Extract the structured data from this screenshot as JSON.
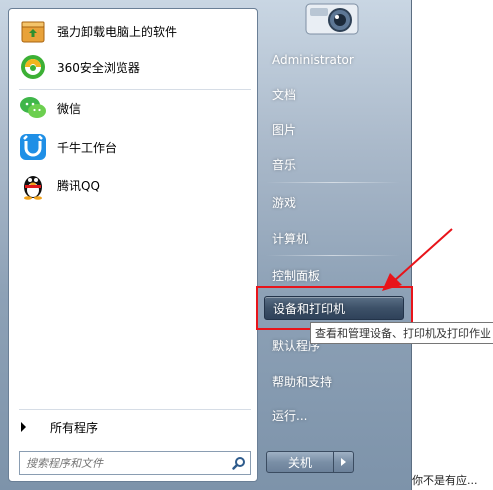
{
  "programs": [
    {
      "label": "强力卸载电脑上的软件",
      "icon": "uninstaller-box-icon"
    },
    {
      "label": "360安全浏览器",
      "icon": "360-browser-icon"
    },
    {
      "label": "微信",
      "icon": "wechat-icon"
    },
    {
      "label": "千牛工作台",
      "icon": "qianniu-icon"
    },
    {
      "label": "腾讯QQ",
      "icon": "qq-penguin-icon"
    }
  ],
  "all_programs": "所有程序",
  "search": {
    "placeholder": "搜索程序和文件"
  },
  "user_name": "Administrator",
  "right_items": [
    "文档",
    "图片",
    "音乐",
    "游戏",
    "计算机",
    "控制面板",
    "设备和打印机",
    "默认程序",
    "帮助和支持",
    "运行..."
  ],
  "tooltip": "查看和管理设备、打印机及打印作业",
  "shutdown_label": "关机",
  "background_text": "你不是有应...",
  "colors": {
    "highlight_box": "#e8141a",
    "arrow": "#e8141a"
  }
}
